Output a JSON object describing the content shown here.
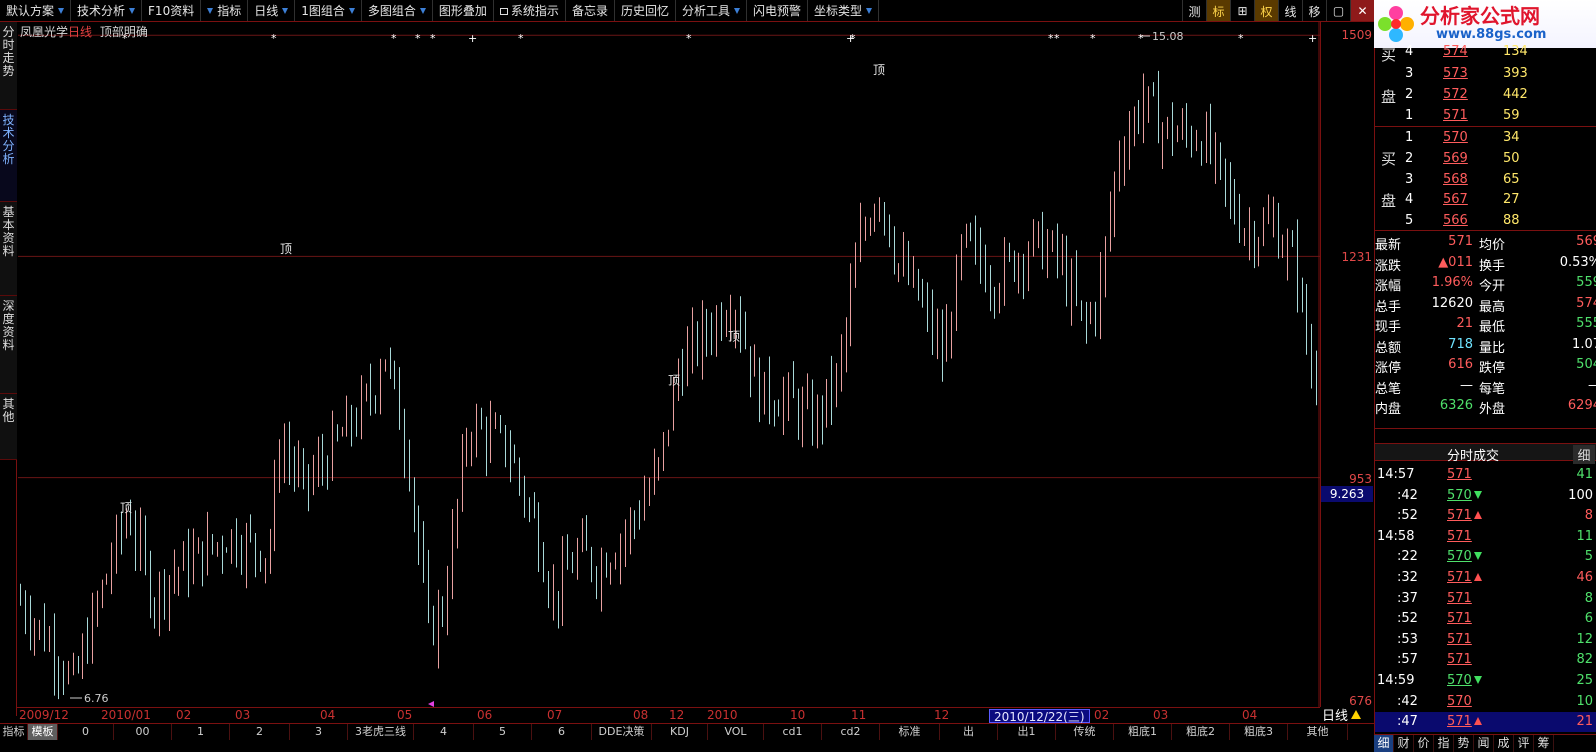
{
  "toolbar": {
    "items": [
      {
        "label": "默认方案",
        "caret": true
      },
      {
        "label": "技术分析",
        "caret": true
      },
      {
        "label": "F10资料",
        "caret": false
      },
      {
        "label": "指标",
        "caret": false,
        "lead": true
      },
      {
        "label": "日线",
        "caret": true
      },
      {
        "label": "1图组合",
        "caret": true
      },
      {
        "label": "多图组合",
        "caret": true
      },
      {
        "label": "图形叠加",
        "caret": false
      },
      {
        "label": "系统指示",
        "caret": false,
        "lock": true
      },
      {
        "label": "备忘录",
        "caret": false
      },
      {
        "label": "历史回忆",
        "caret": false
      },
      {
        "label": "分析工具",
        "caret": true
      },
      {
        "label": "闪电预警",
        "caret": false
      },
      {
        "label": "坐标类型",
        "caret": true
      }
    ],
    "right": [
      "测",
      "标",
      "⊞",
      "权",
      "线",
      "移",
      "▢",
      "✕"
    ]
  },
  "logo": {
    "title": "分析家公式网",
    "url": "www.88gs.com"
  },
  "left_tabs": [
    "分时走势",
    "技术分析",
    "基本资料",
    "深度资料",
    "其他"
  ],
  "chart": {
    "stock_name": "凤凰光学",
    "period": "日线",
    "indicator": "顶部明确",
    "high_label": "15.08",
    "low_label": "6.76",
    "top_marker": "顶",
    "cursor_value": "9.263"
  },
  "chart_data": {
    "type": "bar",
    "ylim": [
      6.76,
      15.08
    ],
    "y_ticks": [
      "1509",
      "1231",
      "953",
      "676"
    ],
    "top_signals": [
      9.1,
      12.35,
      10.7,
      11.25,
      14.6,
      15.3
    ],
    "x_tick_labels": [
      "2009/12",
      "2010/01",
      "02",
      "03",
      "04",
      "05",
      "06",
      "07",
      "08",
      "12",
      "2010",
      "10",
      "11",
      "12",
      "2010/12/22(三)",
      "02",
      "03",
      "04"
    ]
  },
  "xaxis": {
    "period_label": "日线"
  },
  "bottom_tabs": [
    "指标",
    "模板",
    "0",
    "00",
    "1",
    "2",
    "3",
    "3老虎三线",
    "4",
    "5",
    "6",
    "DDE决策",
    "KDJ",
    "VOL",
    "cd1",
    "cd2",
    "标准",
    "出",
    "出1",
    "传统",
    "粗底1",
    "粗底2",
    "粗底3",
    "其他"
  ],
  "quote": {
    "sell": [
      {
        "n": "4",
        "p": "574",
        "v": "134"
      },
      {
        "n": "3",
        "p": "573",
        "v": "393"
      },
      {
        "n": "2",
        "p": "572",
        "v": "442"
      },
      {
        "n": "1",
        "p": "571",
        "v": "59"
      }
    ],
    "buy": [
      {
        "n": "1",
        "p": "570",
        "v": "34"
      },
      {
        "n": "2",
        "p": "569",
        "v": "50"
      },
      {
        "n": "3",
        "p": "568",
        "v": "65"
      },
      {
        "n": "4",
        "p": "567",
        "v": "27"
      },
      {
        "n": "5",
        "p": "566",
        "v": "88"
      }
    ],
    "sell_label": [
      "买",
      "盘"
    ],
    "buy_label": [
      "买",
      "盘"
    ],
    "stats": [
      {
        "l1": "最新",
        "v1": "571",
        "c1": "red",
        "l2": "均价",
        "v2": "569",
        "c2": "red"
      },
      {
        "l1": "涨跌",
        "v1": "▲011",
        "c1": "red",
        "l2": "换手",
        "v2": "0.53%",
        "c2": "white"
      },
      {
        "l1": "涨幅",
        "v1": "1.96%",
        "c1": "red",
        "l2": "今开",
        "v2": "559",
        "c2": "green"
      },
      {
        "l1": "总手",
        "v1": "12620",
        "c1": "white",
        "l2": "最高",
        "v2": "574",
        "c2": "red"
      },
      {
        "l1": "现手",
        "v1": "21",
        "c1": "red",
        "l2": "最低",
        "v2": "555",
        "c2": "green"
      },
      {
        "l1": "总额",
        "v1": "718",
        "c1": "cyan",
        "l2": "量比",
        "v2": "1.07",
        "c2": "white"
      },
      {
        "l1": "涨停",
        "v1": "616",
        "c1": "red",
        "l2": "跌停",
        "v2": "504",
        "c2": "green"
      },
      {
        "l1": "总笔",
        "v1": "—",
        "c1": "white",
        "l2": "每笔",
        "v2": "—",
        "c2": "white"
      },
      {
        "l1": "内盘",
        "v1": "6326",
        "c1": "green",
        "l2": "外盘",
        "v2": "6294",
        "c2": "red"
      }
    ],
    "ticks_title": "分时成交",
    "ticks_fine": "细",
    "ticks": [
      {
        "t": "14:57",
        "p": "571",
        "d": "",
        "v": "41",
        "vc": "green",
        "big": true
      },
      {
        "t": ":42",
        "p": "570",
        "d": "dn",
        "v": "100",
        "vc": "white"
      },
      {
        "t": ":52",
        "p": "571",
        "d": "up",
        "v": "8",
        "vc": "red"
      },
      {
        "t": "14:58",
        "p": "571",
        "d": "",
        "v": "11",
        "vc": "green",
        "big": true
      },
      {
        "t": ":22",
        "p": "570",
        "d": "dn",
        "v": "5",
        "vc": "green"
      },
      {
        "t": ":32",
        "p": "571",
        "d": "up",
        "v": "46",
        "vc": "red"
      },
      {
        "t": ":37",
        "p": "571",
        "d": "",
        "v": "8",
        "vc": "green"
      },
      {
        "t": ":52",
        "p": "571",
        "d": "",
        "v": "6",
        "vc": "green"
      },
      {
        "t": ":53",
        "p": "571",
        "d": "",
        "v": "12",
        "vc": "green"
      },
      {
        "t": ":57",
        "p": "571",
        "d": "",
        "v": "82",
        "vc": "green"
      },
      {
        "t": "14:59",
        "p": "570",
        "d": "dn",
        "v": "25",
        "vc": "green",
        "big": true
      },
      {
        "t": ":42",
        "p": "570",
        "d": "",
        "v": "10",
        "vc": "green"
      },
      {
        "t": ":47",
        "p": "571",
        "d": "up",
        "v": "21",
        "vc": "red",
        "sel": true
      }
    ]
  },
  "panel_tabs": [
    "细",
    "财",
    "价",
    "指",
    "势",
    "闻",
    "成",
    "评",
    "筹"
  ]
}
